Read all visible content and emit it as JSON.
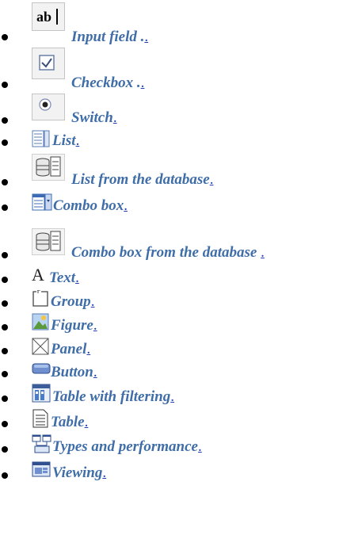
{
  "colors": {
    "label": "#3f6da8",
    "link": "#1f3fb0",
    "bullet": "#000000"
  },
  "items": [
    {
      "label": "Input field .",
      "link": ".",
      "icon": "input-field-icon"
    },
    {
      "label": "Checkbox .",
      "link": ".",
      "icon": "checkbox-icon"
    },
    {
      "label": "Switch",
      "link": ".",
      "icon": "radio-switch-icon"
    },
    {
      "label": "List",
      "link": ".",
      "icon": "list-icon"
    },
    {
      "label": "List from the database",
      "link": ".",
      "icon": "db-list-icon"
    },
    {
      "label": "Combo box",
      "link": ".",
      "icon": "combo-box-icon"
    },
    {
      "label": "Combo box from the database",
      "link": ".",
      "icon": "db-combo-box-icon"
    },
    {
      "label": "Text",
      "link": ".",
      "icon": "text-icon"
    },
    {
      "label": "Group",
      "link": ".",
      "icon": "group-icon"
    },
    {
      "label": "Figure",
      "link": ".",
      "icon": "figure-icon"
    },
    {
      "label": "Panel",
      "link": ".",
      "icon": "panel-icon"
    },
    {
      "label": "Button",
      "link": ".",
      "icon": "button-icon"
    },
    {
      "label": "Table with filtering",
      "link": ".",
      "icon": "filter-table-icon"
    },
    {
      "label": "Table",
      "link": ".",
      "icon": "table-icon"
    },
    {
      "label": "Types and performance",
      "link": ".",
      "icon": "types-icon"
    },
    {
      "label": "Viewing",
      "link": ".",
      "icon": "viewing-icon"
    }
  ]
}
